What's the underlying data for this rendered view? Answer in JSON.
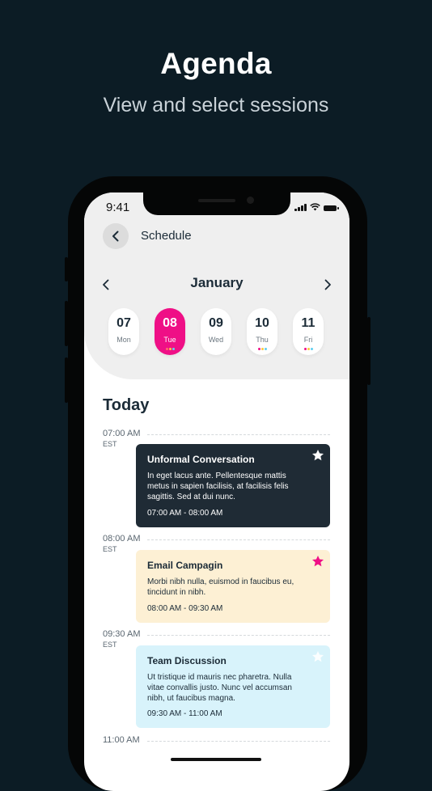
{
  "promo": {
    "title": "Agenda",
    "subtitle": "View and select sessions"
  },
  "status_bar": {
    "time": "9:41",
    "icons": [
      "cellular-signal-icon",
      "wifi-icon",
      "battery-icon"
    ]
  },
  "header": {
    "back_icon": "chevron-left-icon",
    "title": "Schedule"
  },
  "calendar": {
    "month": "January",
    "prev_icon": "chevron-left-icon",
    "next_icon": "chevron-right-icon",
    "days": [
      {
        "num": "07",
        "name": "Mon",
        "selected": false,
        "dots": []
      },
      {
        "num": "08",
        "name": "Tue",
        "selected": true,
        "dots": [
          "#ff6b6b",
          "#ffc83d",
          "#5fd0f0"
        ]
      },
      {
        "num": "09",
        "name": "Wed",
        "selected": false,
        "dots": []
      },
      {
        "num": "10",
        "name": "Thu",
        "selected": false,
        "dots": [
          "#ef0f86",
          "#ffc83d",
          "#5fd0f0"
        ]
      },
      {
        "num": "11",
        "name": "Fri",
        "selected": false,
        "dots": [
          "#ef0f86",
          "#ffc83d",
          "#5fd0f0"
        ]
      }
    ]
  },
  "agenda": {
    "heading": "Today",
    "slots": [
      {
        "time": "07:00 AM",
        "tz": "EST"
      },
      {
        "time": "08:00 AM",
        "tz": "EST"
      },
      {
        "time": "09:30 AM",
        "tz": "EST"
      },
      {
        "time": "11:00 AM",
        "tz": ""
      }
    ],
    "events": [
      {
        "title": "Unformal Conversation",
        "description": "In eget lacus ante. Pellentesque mattis metus in sapien facilisis, at facilisis felis sagittis. Sed at dui nunc.",
        "time": "07:00 AM - 08:00 AM",
        "starred": true,
        "background": "#1f2b35",
        "text_color": "#ffffff",
        "star_color": "#ffffff"
      },
      {
        "title": "Email Campagin",
        "description": "Morbi nibh nulla, euismod in faucibus eu, tincidunt in nibh.",
        "time": "08:00 AM - 09:30 AM",
        "starred": true,
        "background": "#fdf0d4",
        "text_color": "#1b2b37",
        "star_color": "#ef0f86"
      },
      {
        "title": "Team Discussion",
        "description": "Ut tristique id mauris nec pharetra. Nulla vitae convallis justo. Nunc vel accumsan nibh, ut faucibus magna.",
        "time": "09:30 AM - 11:00 AM",
        "starred": false,
        "background": "#d8f3fb",
        "text_color": "#1b2b37",
        "star_color": "#ffffff"
      }
    ]
  },
  "colors": {
    "page_background": "#0c1c25",
    "accent": "#ef0f86",
    "top_area": "#efefef"
  }
}
